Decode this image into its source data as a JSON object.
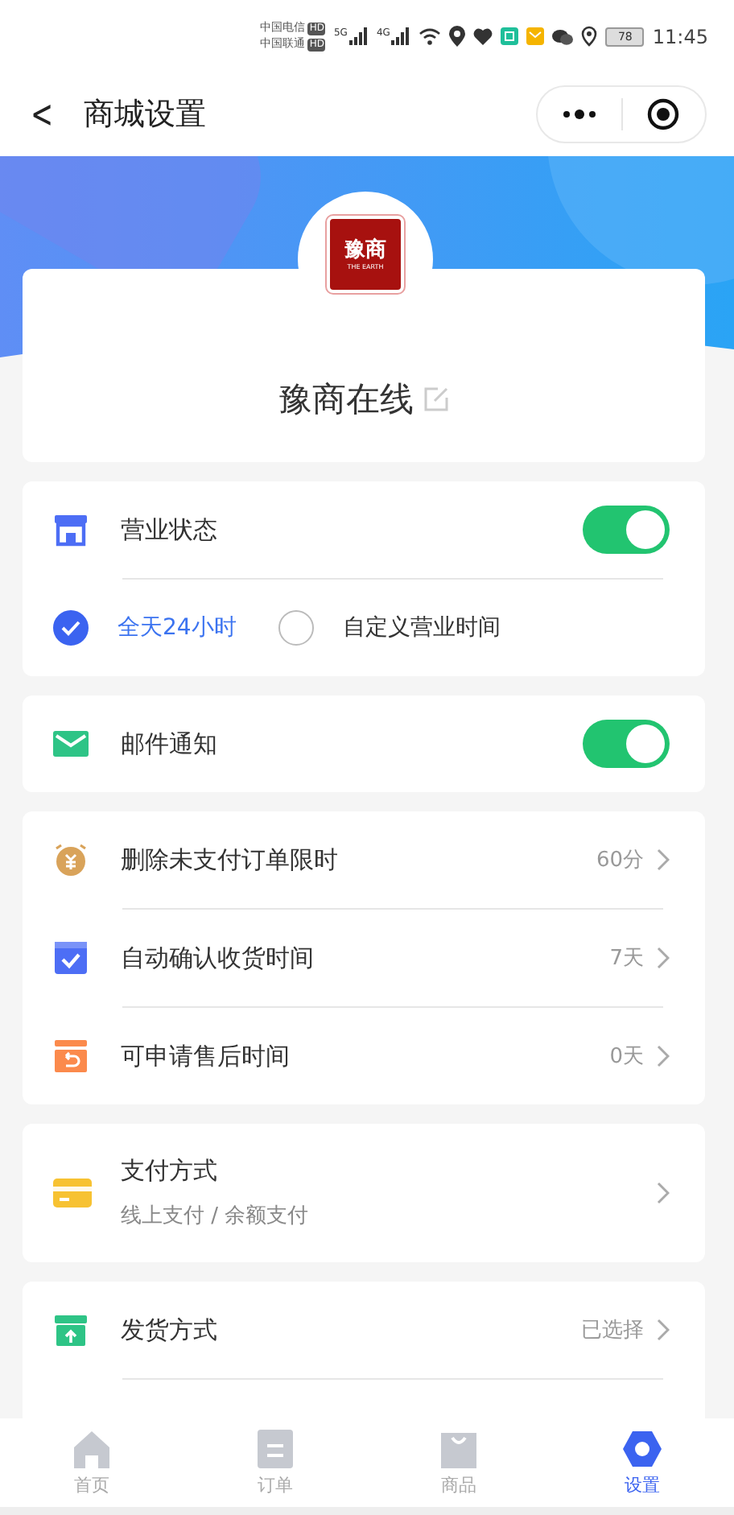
{
  "status_bar": {
    "carriers": [
      {
        "name": "中国电信",
        "badge": "HD"
      },
      {
        "name": "中国联通",
        "badge": "HD"
      }
    ],
    "networks": [
      "5G",
      "4G"
    ],
    "battery": "78",
    "time": "11:45"
  },
  "nav": {
    "back": "<",
    "title": "商城设置"
  },
  "store": {
    "logo_text": "豫商",
    "logo_subtext": "THE EARTH",
    "name": "豫商在线"
  },
  "business": {
    "label": "营业状态",
    "on": true,
    "options": [
      {
        "label": "全天24小时",
        "selected": true
      },
      {
        "label": "自定义营业时间",
        "selected": false
      }
    ]
  },
  "email": {
    "label": "邮件通知",
    "on": true
  },
  "limits": [
    {
      "kind": "clock",
      "label": "删除未支付订单限时",
      "value": "60分"
    },
    {
      "kind": "check",
      "label": "自动确认收货时间",
      "value": "7天"
    },
    {
      "kind": "return",
      "label": "可申请售后时间",
      "value": "0天"
    }
  ],
  "payment": {
    "label": "支付方式",
    "sub": "线上支付 / 余额支付"
  },
  "shipping": {
    "label": "发货方式",
    "value": "已选择"
  },
  "tabs": [
    {
      "kind": "home",
      "label": "首页",
      "selected": false
    },
    {
      "kind": "order",
      "label": "订单",
      "selected": false
    },
    {
      "kind": "bag",
      "label": "商品",
      "selected": false
    },
    {
      "kind": "gear",
      "label": "设置",
      "selected": true
    }
  ]
}
